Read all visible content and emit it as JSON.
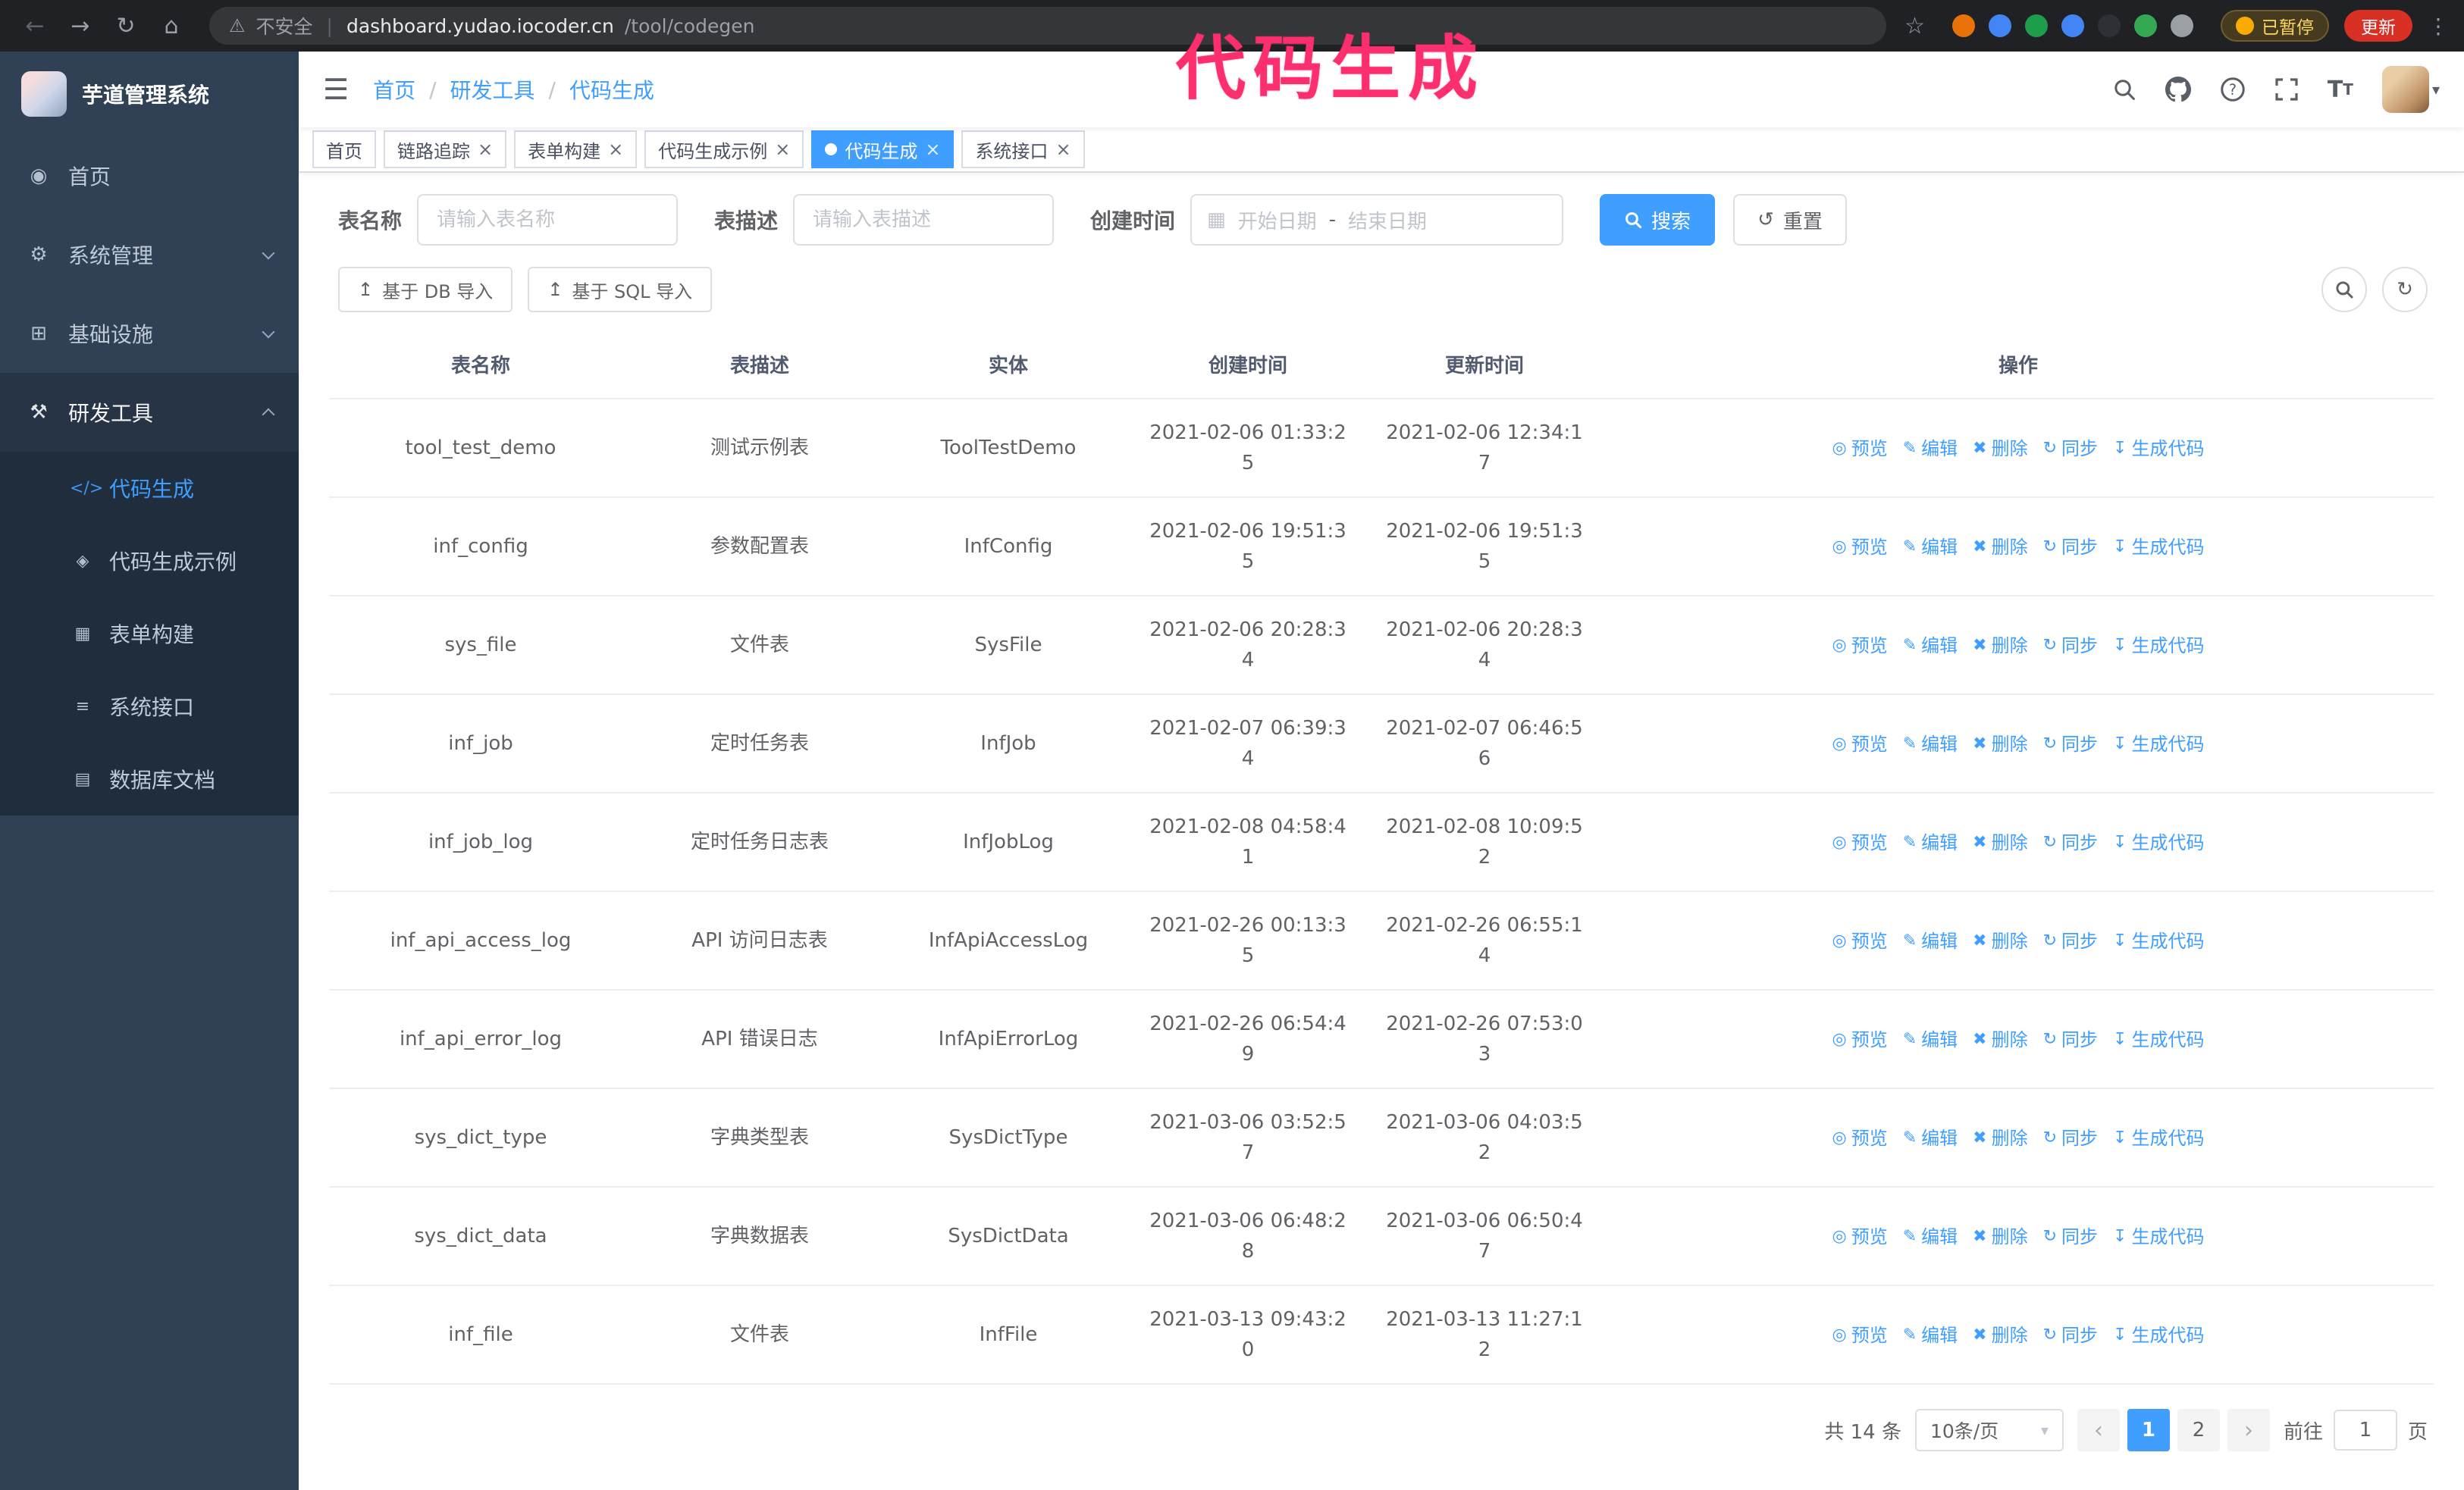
{
  "theme": {
    "accent": "#409eff",
    "sidebar-bg": "#304156",
    "submenu-bg": "#1f2d3d",
    "chrome-bg": "#202124",
    "update-red": "#d93025",
    "annotation-color": "#fb2e6e"
  },
  "annotation": {
    "text": "代码生成"
  },
  "ui": {
    "back": "←",
    "forward": "→",
    "reload": "↻",
    "home": "⌂",
    "warning": "⚠",
    "divider": "|",
    "star": "☆",
    "kebab": "⋮",
    "hamburger": "☰",
    "breadcrumb_separator": "/",
    "caret_down": "▾",
    "close_glyph": "×",
    "range_separator": "-",
    "calendar_glyph": "▦",
    "reset_glyph": "↺",
    "upload_glyph": "↥",
    "refresh_glyph": "↻"
  },
  "browser": {
    "security_label": "不安全",
    "url_host": "dashboard.yudao.iocoder.cn",
    "url_path": "/tool/codegen",
    "paused_badge": "已暂停",
    "update_button": "更新",
    "extension_colors": [
      "#e8710a",
      "#4285f4",
      "#1e9e4a",
      "#4285f4",
      "#2d3136",
      "#34a853",
      "#9aa0a6"
    ]
  },
  "sidebar": {
    "logo_title": "芋道管理系统",
    "menu": [
      {
        "id": "home",
        "label": "首页",
        "glyph": "◉",
        "icon": "dashboard-icon",
        "type": "item"
      },
      {
        "id": "system",
        "label": "系统管理",
        "glyph": "⚙",
        "icon": "gear-icon",
        "type": "submenu",
        "open": false
      },
      {
        "id": "infra",
        "label": "基础设施",
        "glyph": "⊞",
        "icon": "infrastructure-icon",
        "type": "submenu",
        "open": false
      },
      {
        "id": "devtools",
        "label": "研发工具",
        "glyph": "⚒",
        "icon": "tools-icon",
        "type": "submenu",
        "open": true,
        "children": [
          {
            "id": "codegen",
            "label": "代码生成",
            "glyph": "</>",
            "icon": "code-icon",
            "active": true
          },
          {
            "id": "codegen-example",
            "label": "代码生成示例",
            "glyph": "◈",
            "icon": "example-icon"
          },
          {
            "id": "form-builder",
            "label": "表单构建",
            "glyph": "▦",
            "icon": "form-icon"
          },
          {
            "id": "api",
            "label": "系统接口",
            "glyph": "≡",
            "icon": "api-icon"
          },
          {
            "id": "db-doc",
            "label": "数据库文档",
            "glyph": "▤",
            "icon": "database-icon"
          }
        ]
      }
    ]
  },
  "navbar": {
    "breadcrumb": [
      "首页",
      "研发工具",
      "代码生成"
    ]
  },
  "tabs": [
    {
      "id": "home",
      "label": "首页",
      "closable": false,
      "active": false
    },
    {
      "id": "tracing",
      "label": "链路追踪",
      "closable": true,
      "active": false
    },
    {
      "id": "form-builder",
      "label": "表单构建",
      "closable": true,
      "active": false
    },
    {
      "id": "codegen-example",
      "label": "代码生成示例",
      "closable": true,
      "active": false
    },
    {
      "id": "codegen",
      "label": "代码生成",
      "closable": true,
      "active": true
    },
    {
      "id": "api",
      "label": "系统接口",
      "closable": true,
      "active": false
    }
  ],
  "filters": {
    "table_name_label": "表名称",
    "table_name_placeholder": "请输入表名称",
    "table_desc_label": "表描述",
    "table_desc_placeholder": "请输入表描述",
    "create_time_label": "创建时间",
    "start_placeholder": "开始日期",
    "end_placeholder": "结束日期",
    "search_label": "搜索",
    "reset_label": "重置"
  },
  "toolbar": {
    "import_db_label": "基于 DB 导入",
    "import_sql_label": "基于 SQL 导入"
  },
  "table": {
    "columns": [
      "表名称",
      "表描述",
      "实体",
      "创建时间",
      "更新时间",
      "操作"
    ],
    "actions": [
      {
        "id": "preview",
        "label": "预览",
        "glyph": "◎",
        "icon": "eye-icon"
      },
      {
        "id": "edit",
        "label": "编辑",
        "glyph": "✎",
        "icon": "edit-icon"
      },
      {
        "id": "delete",
        "label": "删除",
        "glyph": "✖",
        "icon": "delete-icon"
      },
      {
        "id": "sync",
        "label": "同步",
        "glyph": "↻",
        "icon": "sync-icon"
      },
      {
        "id": "generate",
        "label": "生成代码",
        "glyph": "↧",
        "icon": "download-icon"
      }
    ],
    "rows": [
      {
        "name": "tool_test_demo",
        "desc": "测试示例表",
        "entity": "ToolTestDemo",
        "created": "2021-02-06 01:33:25",
        "updated": "2021-02-06 12:34:17"
      },
      {
        "name": "inf_config",
        "desc": "参数配置表",
        "entity": "InfConfig",
        "created": "2021-02-06 19:51:35",
        "updated": "2021-02-06 19:51:35"
      },
      {
        "name": "sys_file",
        "desc": "文件表",
        "entity": "SysFile",
        "created": "2021-02-06 20:28:34",
        "updated": "2021-02-06 20:28:34"
      },
      {
        "name": "inf_job",
        "desc": "定时任务表",
        "entity": "InfJob",
        "created": "2021-02-07 06:39:34",
        "updated": "2021-02-07 06:46:56"
      },
      {
        "name": "inf_job_log",
        "desc": "定时任务日志表",
        "entity": "InfJobLog",
        "created": "2021-02-08 04:58:41",
        "updated": "2021-02-08 10:09:52"
      },
      {
        "name": "inf_api_access_log",
        "desc": "API 访问日志表",
        "entity": "InfApiAccessLog",
        "created": "2021-02-26 00:13:35",
        "updated": "2021-02-26 06:55:14"
      },
      {
        "name": "inf_api_error_log",
        "desc": "API 错误日志",
        "entity": "InfApiErrorLog",
        "created": "2021-02-26 06:54:49",
        "updated": "2021-02-26 07:53:03"
      },
      {
        "name": "sys_dict_type",
        "desc": "字典类型表",
        "entity": "SysDictType",
        "created": "2021-03-06 03:52:57",
        "updated": "2021-03-06 04:03:52"
      },
      {
        "name": "sys_dict_data",
        "desc": "字典数据表",
        "entity": "SysDictData",
        "created": "2021-03-06 06:48:28",
        "updated": "2021-03-06 06:50:47"
      },
      {
        "name": "inf_file",
        "desc": "文件表",
        "entity": "InfFile",
        "created": "2021-03-13 09:43:20",
        "updated": "2021-03-13 11:27:12"
      }
    ]
  },
  "pagination": {
    "total_text": "共 14 条",
    "page_size_label": "10条/页",
    "prev_icon": "‹",
    "next_icon": "›",
    "pages": [
      "1",
      "2"
    ],
    "active_page": "1",
    "goto_label": "前往",
    "goto_value": "1",
    "goto_suffix": "页"
  }
}
